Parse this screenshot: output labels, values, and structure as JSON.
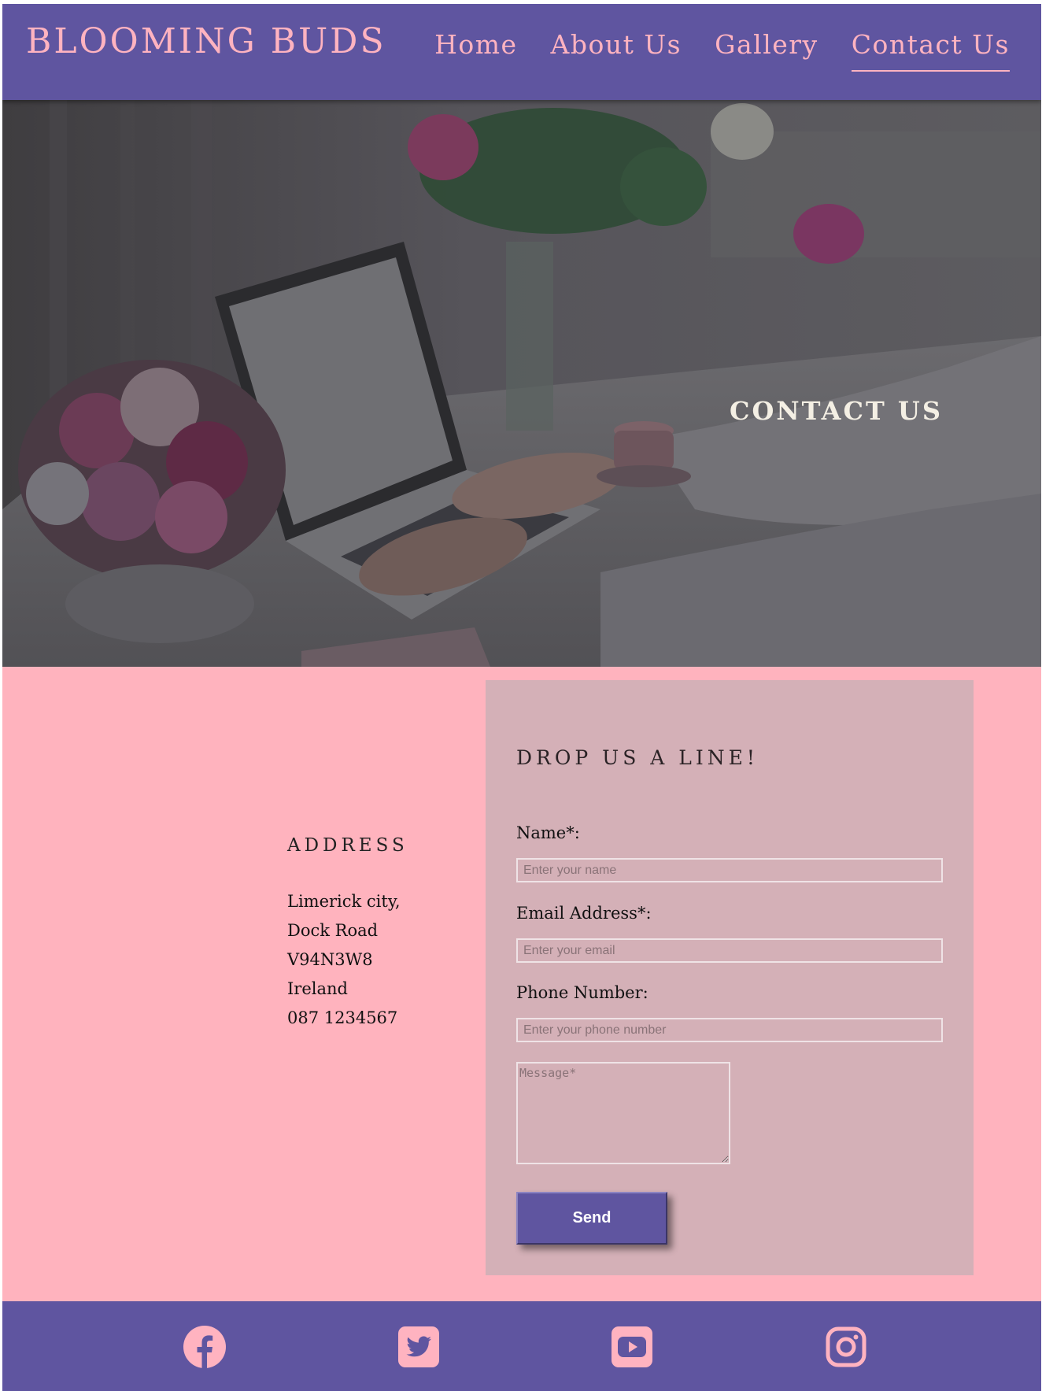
{
  "header": {
    "brand": "BLOOMING BUDS",
    "nav": [
      {
        "label": "Home"
      },
      {
        "label": "About Us"
      },
      {
        "label": "Gallery"
      },
      {
        "label": "Contact Us",
        "active": true
      }
    ]
  },
  "hero": {
    "title": "CONTACT US"
  },
  "address": {
    "heading": "ADDRESS",
    "lines": [
      "Limerick city,",
      "Dock Road",
      "V94N3W8",
      "Ireland",
      "087 1234567"
    ]
  },
  "form": {
    "heading": "DROP US A LINE!",
    "name_label": "Name*:",
    "name_placeholder": "Enter your name",
    "email_label": "Email Address*:",
    "email_placeholder": "Enter your email",
    "phone_label": "Phone Number:",
    "phone_placeholder": "Enter your phone number",
    "message_placeholder": "Message*",
    "send_label": "Send"
  },
  "footer": {
    "social": [
      {
        "icon": "facebook-icon"
      },
      {
        "icon": "twitter-icon"
      },
      {
        "icon": "youtube-icon"
      },
      {
        "icon": "instagram-icon"
      }
    ]
  },
  "colors": {
    "header_bg": "#5f55a0",
    "brand_pink": "#ffb3c0",
    "main_bg": "#ffb3be",
    "form_card_bg": "#d4b0b7",
    "button_bg": "#5f55a0"
  }
}
